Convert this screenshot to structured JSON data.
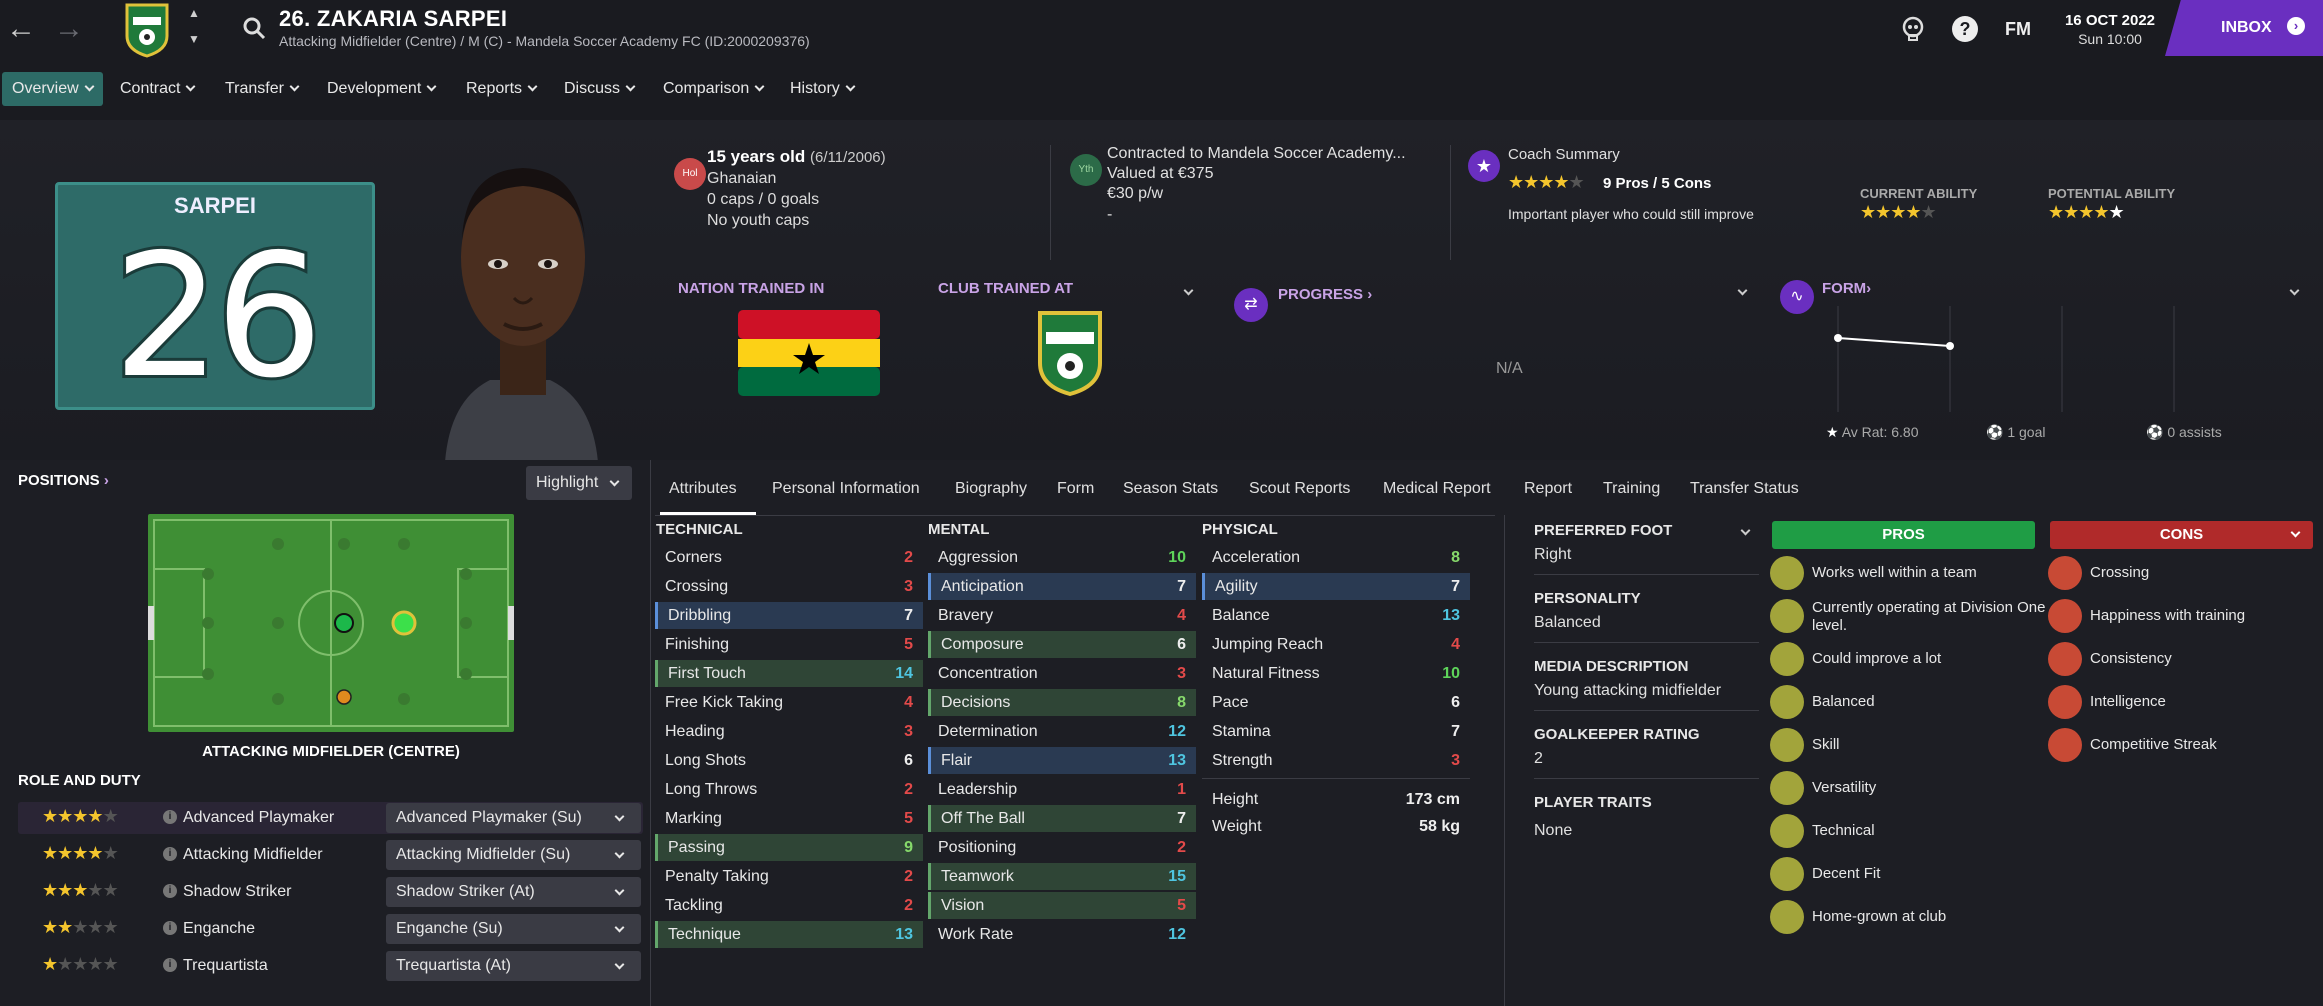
{
  "header": {
    "title": "26. ZAKARIA SARPEI",
    "subtitle": "Attacking Midfielder (Centre) / M (C) - Mandela Soccer Academy FC (ID:2000209376)",
    "date": "16 OCT 2022",
    "time": "Sun 10:00",
    "fm_label": "FM",
    "inbox_label": "INBOX"
  },
  "menu": [
    {
      "label": "Overview"
    },
    {
      "label": "Contract"
    },
    {
      "label": "Transfer"
    },
    {
      "label": "Development"
    },
    {
      "label": "Reports"
    },
    {
      "label": "Discuss"
    },
    {
      "label": "Comparison"
    },
    {
      "label": "History"
    }
  ],
  "jersey": {
    "name": "SARPEI",
    "number": "26"
  },
  "info": {
    "age_badge": "Hol",
    "age": "15 years old",
    "dob": "(6/11/2006)",
    "nationality": "Ghanaian",
    "caps": "0 caps / 0 goals",
    "youth_caps": "No youth caps",
    "contract_badge": "Yth",
    "contract": "Contracted to Mandela Soccer Academy...",
    "value": "Valued at €375",
    "wage": "€30 p/w",
    "contract_extra": "-"
  },
  "coach": {
    "title": "Coach Summary",
    "pros_cons": "9 Pros / 5 Cons",
    "summary": "Important player who could still improve",
    "current_ability_label": "CURRENT ABILITY",
    "potential_ability_label": "POTENTIAL ABILITY",
    "coach_stars": 3.5,
    "current_stars": 3.5,
    "potential_stars": 4.5
  },
  "trained": {
    "nation_label": "NATION TRAINED IN",
    "club_label": "CLUB TRAINED AT",
    "progress_label": "PROGRESS",
    "progress_value": "N/A",
    "form_label": "FORM",
    "av_rat": "Av Rat: 6.80",
    "goals": "1 goal",
    "assists": "0 assists"
  },
  "positions": {
    "label": "POSITIONS",
    "highlight": "Highlight",
    "position_name": "ATTACKING MIDFIELDER (CENTRE)",
    "role_duty_label": "ROLE AND DUTY"
  },
  "roles": [
    {
      "name": "Advanced Playmaker",
      "duty": "Advanced Playmaker (Su)",
      "stars": 3.5
    },
    {
      "name": "Attacking Midfielder",
      "duty": "Attacking Midfielder (Su)",
      "stars": 3.5
    },
    {
      "name": "Shadow Striker",
      "duty": "Shadow Striker (At)",
      "stars": 3
    },
    {
      "name": "Enganche",
      "duty": "Enganche (Su)",
      "stars": 1.5
    },
    {
      "name": "Trequartista",
      "duty": "Trequartista (At)",
      "stars": 1
    }
  ],
  "tabs": [
    "Attributes",
    "Personal Information",
    "Biography",
    "Form",
    "Season Stats",
    "Scout Reports",
    "Medical Report",
    "Report",
    "Training",
    "Transfer Status"
  ],
  "technical": {
    "label": "TECHNICAL",
    "rows": [
      {
        "name": "Corners",
        "value": "2"
      },
      {
        "name": "Crossing",
        "value": "3"
      },
      {
        "name": "Dribbling",
        "value": "7"
      },
      {
        "name": "Finishing",
        "value": "5"
      },
      {
        "name": "First Touch",
        "value": "14"
      },
      {
        "name": "Free Kick Taking",
        "value": "4"
      },
      {
        "name": "Heading",
        "value": "3"
      },
      {
        "name": "Long Shots",
        "value": "6"
      },
      {
        "name": "Long Throws",
        "value": "2"
      },
      {
        "name": "Marking",
        "value": "5"
      },
      {
        "name": "Passing",
        "value": "9"
      },
      {
        "name": "Penalty Taking",
        "value": "2"
      },
      {
        "name": "Tackling",
        "value": "2"
      },
      {
        "name": "Technique",
        "value": "13"
      }
    ]
  },
  "mental": {
    "label": "MENTAL",
    "rows": [
      {
        "name": "Aggression",
        "value": "10"
      },
      {
        "name": "Anticipation",
        "value": "7"
      },
      {
        "name": "Bravery",
        "value": "4"
      },
      {
        "name": "Composure",
        "value": "6"
      },
      {
        "name": "Concentration",
        "value": "3"
      },
      {
        "name": "Decisions",
        "value": "8"
      },
      {
        "name": "Determination",
        "value": "12"
      },
      {
        "name": "Flair",
        "value": "13"
      },
      {
        "name": "Leadership",
        "value": "1"
      },
      {
        "name": "Off The Ball",
        "value": "7"
      },
      {
        "name": "Positioning",
        "value": "2"
      },
      {
        "name": "Teamwork",
        "value": "15"
      },
      {
        "name": "Vision",
        "value": "5"
      },
      {
        "name": "Work Rate",
        "value": "12"
      }
    ]
  },
  "physical": {
    "label": "PHYSICAL",
    "rows": [
      {
        "name": "Acceleration",
        "value": "8"
      },
      {
        "name": "Agility",
        "value": "7"
      },
      {
        "name": "Balance",
        "value": "13"
      },
      {
        "name": "Jumping Reach",
        "value": "4"
      },
      {
        "name": "Natural Fitness",
        "value": "10"
      },
      {
        "name": "Pace",
        "value": "6"
      },
      {
        "name": "Stamina",
        "value": "7"
      },
      {
        "name": "Strength",
        "value": "3"
      }
    ],
    "height_label": "Height",
    "height": "173 cm",
    "weight_label": "Weight",
    "weight": "58 kg"
  },
  "details": {
    "foot_label": "PREFERRED FOOT",
    "foot": "Right",
    "personality_label": "PERSONALITY",
    "personality": "Balanced",
    "media_label": "MEDIA DESCRIPTION",
    "media": "Young attacking midfielder",
    "gk_label": "GOALKEEPER RATING",
    "gk": "2",
    "traits_label": "PLAYER TRAITS",
    "traits": "None"
  },
  "pros": {
    "label": "PROS",
    "items": [
      "Works well within a team",
      "Currently operating at Division One level.",
      "Could improve a lot",
      "Balanced",
      "Skill",
      "Versatility",
      "Technical",
      "Decent Fit",
      "Home-grown at club"
    ]
  },
  "cons": {
    "label": "CONS",
    "items": [
      "Crossing",
      "Happiness with training",
      "Consistency",
      "Intelligence",
      "Competitive Streak"
    ]
  },
  "colors": {
    "accent": "#6a2fc0",
    "teal": "#2d6b66",
    "pros": "#1f9d45",
    "cons": "#b02a2a"
  }
}
